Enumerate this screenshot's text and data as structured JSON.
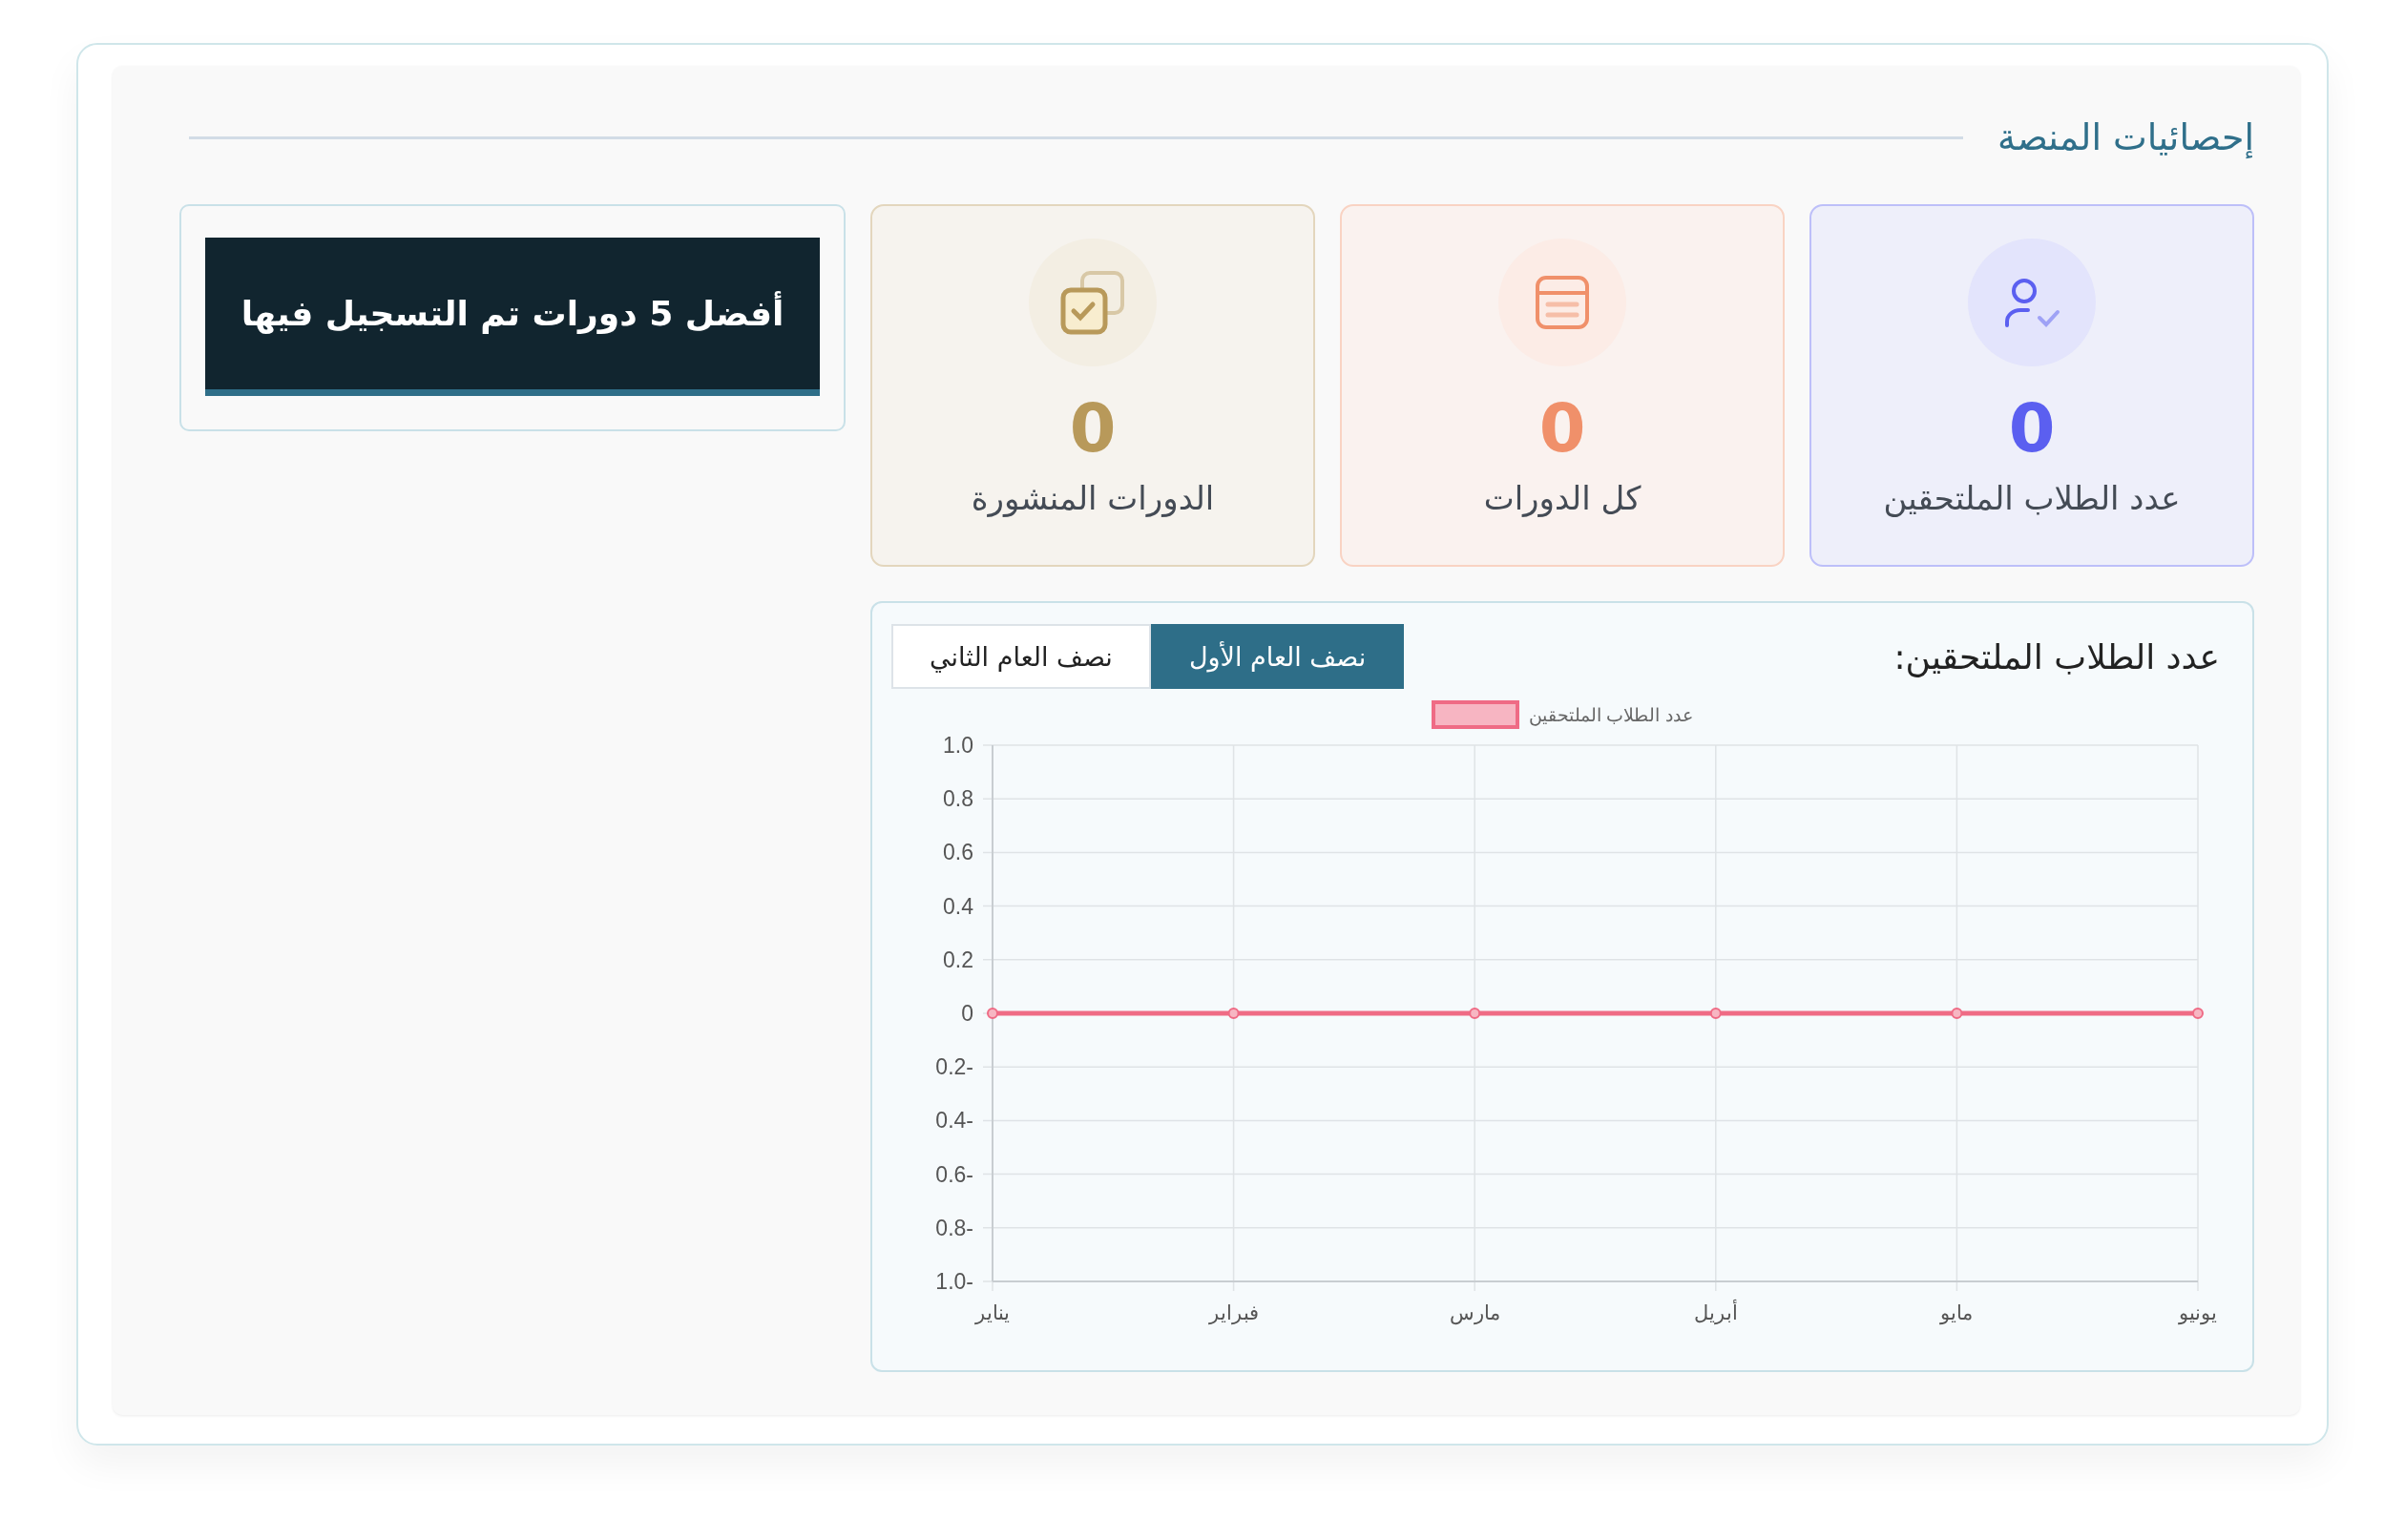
{
  "section_title": "إحصائيات المنصة",
  "stats": [
    {
      "kind": "students",
      "value": "0",
      "label": "عدد الطلاب الملتحقين",
      "color": "#5b5ff0"
    },
    {
      "kind": "courses",
      "value": "0",
      "label": "كل الدورات",
      "color": "#f0906a"
    },
    {
      "kind": "published",
      "value": "0",
      "label": "الدورات المنشورة",
      "color": "#b8995a"
    }
  ],
  "top_courses": {
    "title": "أفضل 5 دورات تم التسجيل فيها"
  },
  "enrollment_chart": {
    "title": "عدد الطلاب الملتحقين:",
    "tabs": [
      {
        "label": "نصف العام الأول",
        "selected": true
      },
      {
        "label": "نصف العام الثاني",
        "selected": false
      }
    ],
    "chart_data": {
      "type": "line",
      "categories": [
        "يناير",
        "فبراير",
        "مارس",
        "أبريل",
        "مايو",
        "يونيو"
      ],
      "series": [
        {
          "name": "عدد الطلاب الملتحقين",
          "color": "#ef6b85",
          "marker": true,
          "values": [
            0,
            0,
            0,
            0,
            0,
            0
          ]
        }
      ],
      "ylim": [
        -1,
        1
      ],
      "grid": true,
      "yticks": [
        {
          "value": 1,
          "label": "1.0"
        },
        {
          "value": 0.8,
          "label": "0.8"
        },
        {
          "value": 0.6,
          "label": "0.6"
        },
        {
          "value": 0.4,
          "label": "0.4"
        },
        {
          "value": 0.2,
          "label": "0.2"
        },
        {
          "value": 0,
          "label": "0"
        },
        {
          "value": -0.2,
          "label": "0.2-"
        },
        {
          "value": -0.4,
          "label": "0.4-"
        },
        {
          "value": -0.6,
          "label": "0.6-"
        },
        {
          "value": -0.8,
          "label": "0.8-"
        },
        {
          "value": -1,
          "label": "1.0-"
        }
      ]
    }
  }
}
